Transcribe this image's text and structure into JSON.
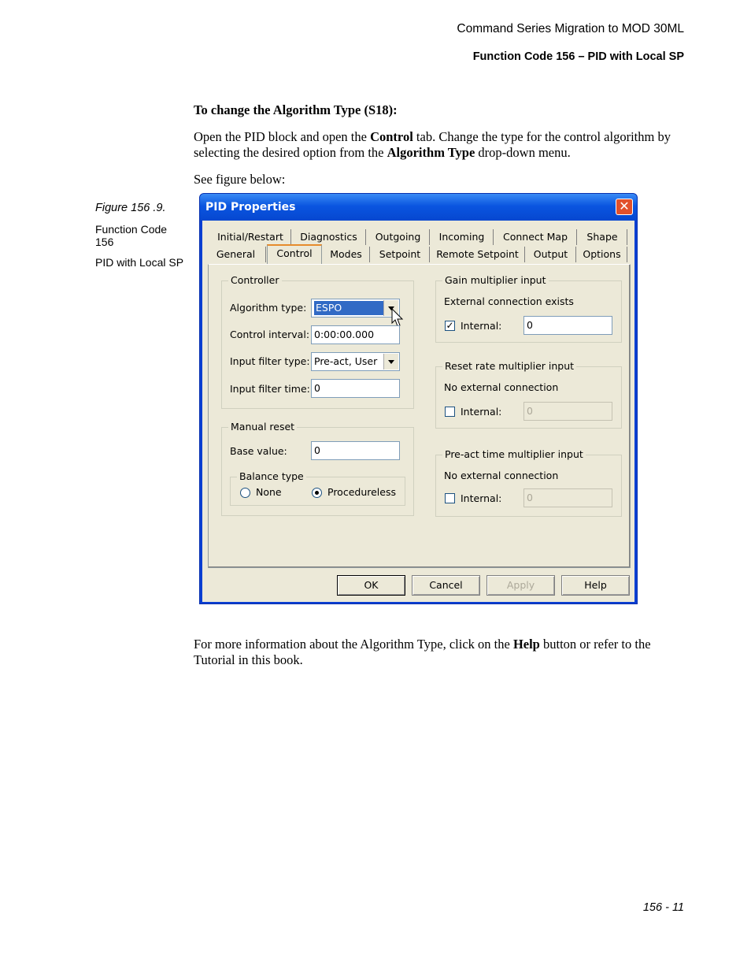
{
  "header": {
    "line1": "Command Series Migration to MOD 30ML",
    "line2": "Function Code 156 – PID with Local SP"
  },
  "body": {
    "heading": "To change the Algorithm Type (S18):",
    "para1_a": "Open the PID block and open the ",
    "para1_b": "Control",
    "para1_c": " tab. Change the type for the control algorithm by selecting the desired option from the ",
    "para1_d": "Algorithm Type",
    "para1_e": " drop-down menu.",
    "see": "See figure below:",
    "para2_a": "For more information about the Algorithm Type, click on the ",
    "para2_b": "Help",
    "para2_c": " button or refer to the Tutorial in this book."
  },
  "sidebar": {
    "figure": "Figure 156 .9.",
    "label1": "Function Code 156",
    "label2": "PID with Local SP"
  },
  "dialog": {
    "title": "PID Properties",
    "close": "✕",
    "tabs_row1": [
      "Initial/Restart",
      "Diagnostics",
      "Outgoing",
      "Incoming",
      "Connect Map",
      "Shape"
    ],
    "tabs_row2": [
      "General",
      "Control",
      "Modes",
      "Setpoint",
      "Remote Setpoint",
      "Output",
      "Options"
    ],
    "controller": {
      "label": "Controller",
      "algorithm_label": "Algorithm type:",
      "algorithm_value": "ESPO",
      "interval_label": "Control interval:",
      "interval_value": "0:00:00.000",
      "filter_type_label": "Input filter type:",
      "filter_type_value": "Pre-act, User",
      "filter_time_label": "Input filter time:",
      "filter_time_value": "0"
    },
    "manual_reset": {
      "label": "Manual reset",
      "base_label": "Base value:",
      "base_value": "0",
      "balance_label": "Balance type",
      "none": "None",
      "procedureless": "Procedureless"
    },
    "gain": {
      "label": "Gain multiplier input",
      "status": "External connection exists",
      "internal": "Internal:",
      "value": "0",
      "checked": "✓"
    },
    "reset": {
      "label": "Reset rate multiplier input",
      "status": "No external connection",
      "internal": "Internal:",
      "value": "0"
    },
    "preact": {
      "label": "Pre-act time multiplier input",
      "status": "No external connection",
      "internal": "Internal:",
      "value": "0"
    },
    "buttons": {
      "ok": "OK",
      "cancel": "Cancel",
      "apply": "Apply",
      "help": "Help"
    }
  },
  "footer": {
    "page": "156 - 11"
  }
}
